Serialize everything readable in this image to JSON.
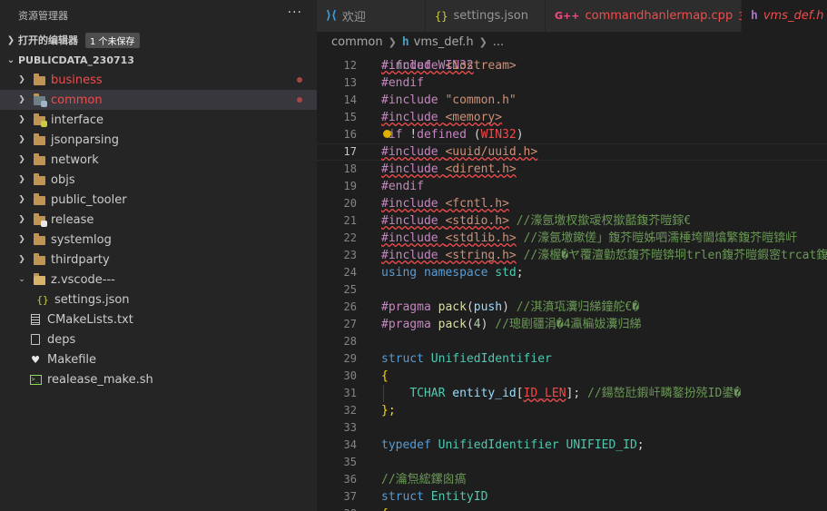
{
  "sidebar": {
    "title": "资源管理器",
    "more": "···",
    "open_editors": {
      "label": "打开的编辑器",
      "badge": "1 个未保存"
    },
    "project": {
      "label": "PUBLICDATA_230713"
    },
    "tree": [
      {
        "label": "business",
        "kind": "folder",
        "color": "#f14c4c",
        "modified": true
      },
      {
        "label": "common",
        "kind": "folder",
        "color": "#f14c4c",
        "modified": true,
        "selected": true
      },
      {
        "label": "interface",
        "kind": "folder",
        "color": "#cccccc"
      },
      {
        "label": "jsonparsing",
        "kind": "folder",
        "color": "#cccccc"
      },
      {
        "label": "network",
        "kind": "folder",
        "color": "#cccccc"
      },
      {
        "label": "objs",
        "kind": "folder",
        "color": "#cccccc"
      },
      {
        "label": "public_tooler",
        "kind": "folder",
        "color": "#cccccc"
      },
      {
        "label": "release",
        "kind": "folder",
        "color": "#cccccc"
      },
      {
        "label": "systemlog",
        "kind": "folder",
        "color": "#cccccc"
      },
      {
        "label": "thirdparty",
        "kind": "folder",
        "color": "#cccccc"
      },
      {
        "label": "z.vscode---",
        "kind": "folder-open",
        "color": "#cccccc"
      },
      {
        "label": "settings.json",
        "kind": "json",
        "color": "#cccccc"
      },
      {
        "label": "CMakeLists.txt",
        "kind": "txt",
        "color": "#cccccc"
      },
      {
        "label": "deps",
        "kind": "file",
        "color": "#cccccc"
      },
      {
        "label": "Makefile",
        "kind": "makefile",
        "color": "#cccccc"
      },
      {
        "label": "realease_make.sh",
        "kind": "shell",
        "color": "#cccccc"
      }
    ]
  },
  "tabs": [
    {
      "label": "欢迎",
      "icon": "vscode-icon"
    },
    {
      "label": "settings.json",
      "icon": "json-icon",
      "dirty": true
    },
    {
      "label": "commandhanlermap.cpp",
      "icon": "cpp-icon",
      "count": "3",
      "error": true
    },
    {
      "label": "vms_def.h",
      "icon": "header-icon",
      "error": true,
      "active": true
    }
  ],
  "breadcrumb": {
    "folder": "common",
    "file": "vms_def.h",
    "more": "..."
  },
  "editor": {
    "current_line": "17",
    "partial_top": "#ifndef WIN32",
    "lines": [
      {
        "n": "12",
        "text": "#include <iostream>"
      },
      {
        "n": "13",
        "text": "#endif"
      },
      {
        "n": "14",
        "text": "#include \"common.h\""
      },
      {
        "n": "15",
        "text": "#include <memory>"
      },
      {
        "n": "16",
        "text": "#if !defined (WIN32)"
      },
      {
        "n": "17",
        "text": "#include <uuid/uuid.h>"
      },
      {
        "n": "18",
        "text": "#include <dirent.h>"
      },
      {
        "n": "19",
        "text": "#endif"
      },
      {
        "n": "20",
        "text": "#include <fcntl.h>"
      },
      {
        "n": "21",
        "text": "#include <stdio.h>",
        "comment": "//濠氬墽杈撳叆杈撳嚭鍑芥暟鎵€"
      },
      {
        "n": "22",
        "text": "#include <stdlib.h>",
        "comment": "//濠氬墽鏉傞」鍑芥暟姊呬濡棰垮閫熻繁鍑芥暟锛屽"
      },
      {
        "n": "23",
        "text": "#include <string.h>",
        "comment": "//濠楃�ヤ覆澶勭悊鍑芥暟锛坰trlen鍑芥暟鍜宻trcat鍑"
      },
      {
        "n": "24",
        "text": "using namespace std;"
      },
      {
        "n": "25",
        "text": ""
      },
      {
        "n": "26",
        "text": "#pragma pack(push)",
        "comment": "//淇濆瓨瀵归綈鐘舵€�"
      },
      {
        "n": "27",
        "text": "#pragma pack(4)",
        "comment": "//璁剧疆涓�4瀛楄妭瀵归綈"
      },
      {
        "n": "28",
        "text": ""
      },
      {
        "n": "29",
        "text": "struct UnifiedIdentifier"
      },
      {
        "n": "30",
        "text": "{"
      },
      {
        "n": "31",
        "text": "    TCHAR entity_id[ID_LEN];",
        "comment": "//鍚嶅瓧鍜屽疄鐜扮殑ID鍙�"
      },
      {
        "n": "32",
        "text": "};"
      },
      {
        "n": "33",
        "text": ""
      },
      {
        "n": "34",
        "text": "typedef UnifiedIdentifier UNIFIED_ID;"
      },
      {
        "n": "35",
        "text": ""
      },
      {
        "n": "36",
        "text": "//瀹炰綋鏍囪瘑"
      },
      {
        "n": "37",
        "text": "struct EntityID"
      },
      {
        "n": "38",
        "text": "{"
      }
    ]
  },
  "colors": {
    "sidebar_bg": "#252526",
    "editor_bg": "#1e1e1e",
    "error_red": "#f14c4c",
    "keyword_blue": "#569cd6",
    "preprocessor_purple": "#c586c0",
    "string_orange": "#ce9178",
    "comment_green": "#6a9955",
    "type_teal": "#4ec9b0"
  }
}
